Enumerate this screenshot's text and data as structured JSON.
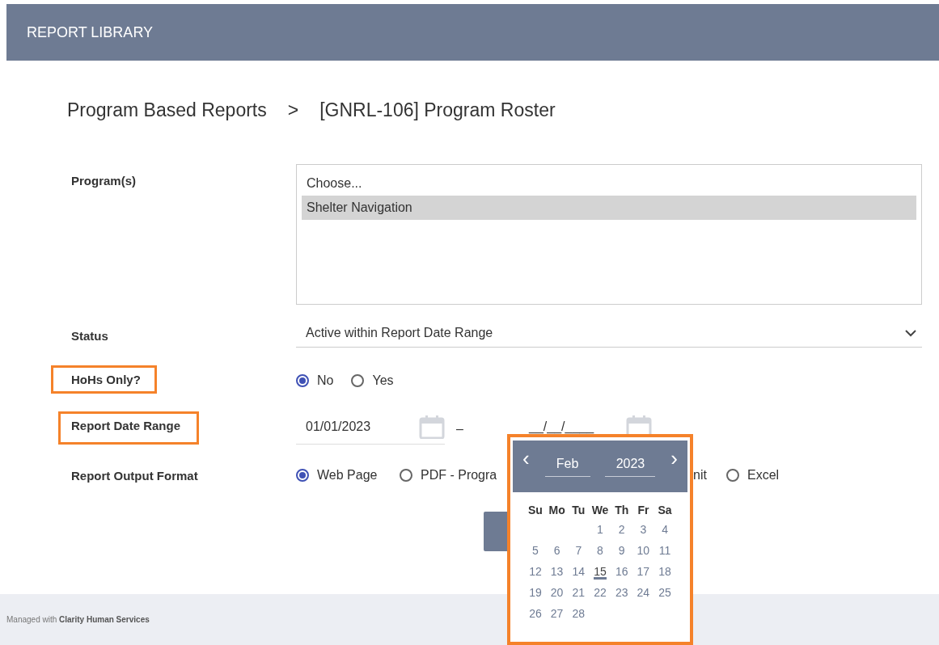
{
  "header": {
    "title": "REPORT LIBRARY"
  },
  "breadcrumb": [
    {
      "label": "Program Based Reports"
    },
    {
      "label": ">"
    },
    {
      "label": "[GNRL-106] Program Roster"
    }
  ],
  "programs": {
    "label": "Program(s)",
    "highlighted": false,
    "options": [
      {
        "label": "Choose...",
        "selected": false
      },
      {
        "label": "Shelter Navigation",
        "selected": true
      }
    ]
  },
  "status": {
    "label": "Status",
    "highlighted": false,
    "value": "Active within Report Date Range"
  },
  "hohs_only": {
    "label": "HoHs Only?",
    "highlighted": true,
    "options": [
      {
        "kind": "radio",
        "label": "No",
        "selected": true
      },
      {
        "kind": "radio",
        "label": "Yes",
        "selected": false
      }
    ]
  },
  "date_range": {
    "label": "Report Date Range",
    "highlighted": true,
    "start": "01/01/2023",
    "separator": "–",
    "end_placeholder": "__/__/____"
  },
  "output_format": {
    "label": "Report Output Format",
    "highlighted": false,
    "options": [
      {
        "kind": "radio",
        "label": "Web Page",
        "selected": true
      },
      {
        "kind": "radio",
        "label": "PDF - Progra",
        "selected": false
      },
      {
        "kind": "fragment",
        "label": "nit"
      },
      {
        "kind": "radio",
        "label": "Excel",
        "selected": false
      }
    ]
  },
  "calendar": {
    "highlighted": true,
    "prev": "‹",
    "next": "›",
    "month": "Feb",
    "year": "2023",
    "weekdays": [
      "Su",
      "Mo",
      "Tu",
      "We",
      "Th",
      "Fr",
      "Sa"
    ],
    "days": [
      {
        "kind": "blank"
      },
      {
        "kind": "blank"
      },
      {
        "kind": "blank"
      },
      {
        "kind": "day",
        "day": "1",
        "today": false
      },
      {
        "kind": "day",
        "day": "2",
        "today": false
      },
      {
        "kind": "day",
        "day": "3",
        "today": false
      },
      {
        "kind": "day",
        "day": "4",
        "today": false
      },
      {
        "kind": "day",
        "day": "5",
        "today": false
      },
      {
        "kind": "day",
        "day": "6",
        "today": false
      },
      {
        "kind": "day",
        "day": "7",
        "today": false
      },
      {
        "kind": "day",
        "day": "8",
        "today": false
      },
      {
        "kind": "day",
        "day": "9",
        "today": false
      },
      {
        "kind": "day",
        "day": "10",
        "today": false
      },
      {
        "kind": "day",
        "day": "11",
        "today": false
      },
      {
        "kind": "day",
        "day": "12",
        "today": false
      },
      {
        "kind": "day",
        "day": "13",
        "today": false
      },
      {
        "kind": "day",
        "day": "14",
        "today": false
      },
      {
        "kind": "day",
        "day": "15",
        "today": true
      },
      {
        "kind": "day",
        "day": "16",
        "today": false
      },
      {
        "kind": "day",
        "day": "17",
        "today": false
      },
      {
        "kind": "day",
        "day": "18",
        "today": false
      },
      {
        "kind": "day",
        "day": "19",
        "today": false
      },
      {
        "kind": "day",
        "day": "20",
        "today": false
      },
      {
        "kind": "day",
        "day": "21",
        "today": false
      },
      {
        "kind": "day",
        "day": "22",
        "today": false
      },
      {
        "kind": "day",
        "day": "23",
        "today": false
      },
      {
        "kind": "day",
        "day": "24",
        "today": false
      },
      {
        "kind": "day",
        "day": "25",
        "today": false
      },
      {
        "kind": "day",
        "day": "26",
        "today": false
      },
      {
        "kind": "day",
        "day": "27",
        "today": false
      },
      {
        "kind": "day",
        "day": "28",
        "today": false
      }
    ]
  },
  "footer": {
    "text": "Managed with **Clarity Human Services**"
  }
}
